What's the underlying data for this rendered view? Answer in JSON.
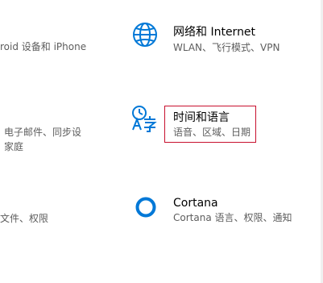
{
  "left_column": {
    "item1_desc": "roid 设备和 iPhone",
    "item2_desc_line1": "电子邮件、同步设",
    "item2_desc_line2": "家庭",
    "item3_desc": "文件、权限"
  },
  "tiles": [
    {
      "title": "网络和 Internet",
      "desc": "WLAN、飞行模式、VPN",
      "icon": "globe-icon"
    },
    {
      "title": "时间和语言",
      "desc": "语音、区域、日期",
      "icon": "time-language-icon"
    },
    {
      "title": "Cortana",
      "desc": "Cortana 语言、权限、通知",
      "icon": "cortana-ring-icon"
    }
  ],
  "colors": {
    "accent": "#0078d7",
    "highlight_border": "#c8102e",
    "secondary_text": "#5d5d5d"
  }
}
